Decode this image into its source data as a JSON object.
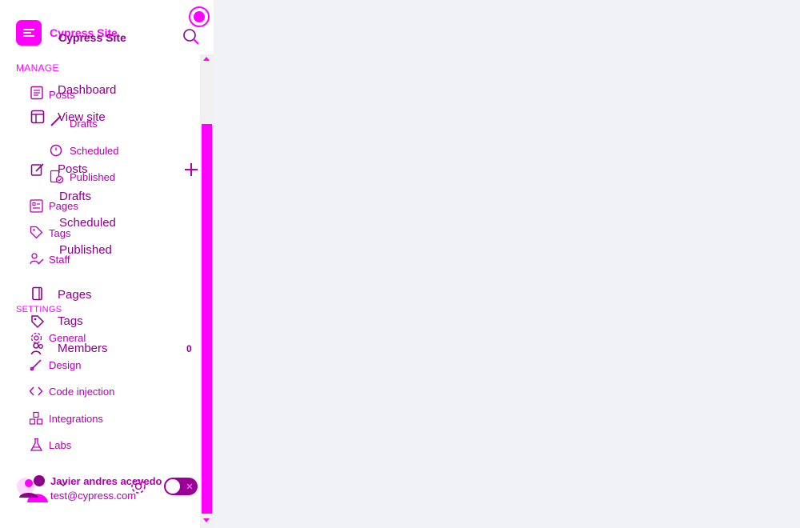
{
  "site": {
    "title": "Cypress Site",
    "title_overlay": "Cypress Site"
  },
  "sections": {
    "manage": "MANAGE",
    "settings": "SETTINGS"
  },
  "nav_overlay": {
    "dashboard": "Dashboard",
    "view_site": "View site",
    "posts": "Posts",
    "drafts": "Drafts",
    "scheduled": "Scheduled",
    "published": "Published",
    "pages": "Pages",
    "tags": "Tags",
    "members": "Members",
    "members_count": "0"
  },
  "nav": {
    "posts": "Posts",
    "drafts": "Drafts",
    "scheduled": "Scheduled",
    "published": "Published",
    "pages": "Pages",
    "tags": "Tags",
    "staff": "Staff"
  },
  "settings_nav": {
    "general": "General",
    "design": "Design",
    "code_injection": "Code injection",
    "integrations": "Integrations",
    "labs": "Labs"
  },
  "user": {
    "name": "Javier andres acevedo",
    "email": "test@cypress.com"
  },
  "colors": {
    "accent": "#ff00ff",
    "text_dark": "#8b008b",
    "background": "#f1f2f6"
  }
}
